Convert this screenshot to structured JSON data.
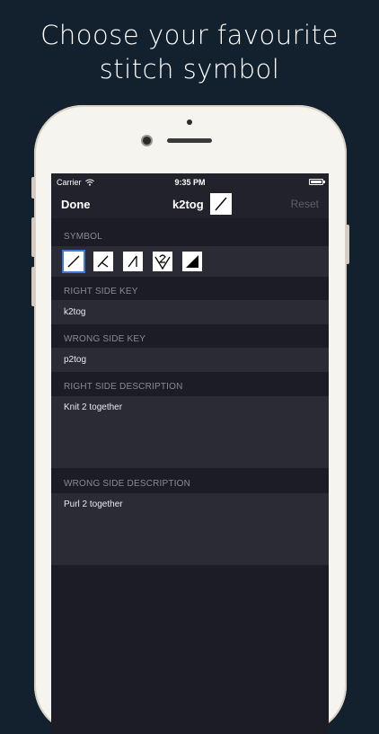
{
  "headline": {
    "line1": "Choose your favourite",
    "line2": "stitch symbol"
  },
  "status_bar": {
    "carrier": "Carrier",
    "time": "9:35 PM"
  },
  "nav": {
    "done_label": "Done",
    "title": "k2tog",
    "reset_label": "Reset"
  },
  "symbol_section": {
    "label": "SYMBOL",
    "options": [
      "k2tog-symbol-icon",
      "k-symbol-icon",
      "slash-left-symbol-icon",
      "twisted-two-symbol-icon",
      "bind-off-symbol-icon"
    ],
    "selected_index": 0
  },
  "right_side_key": {
    "label": "RIGHT SIDE KEY",
    "value": "k2tog"
  },
  "wrong_side_key": {
    "label": "WRONG SIDE KEY",
    "value": "p2tog"
  },
  "right_side_description": {
    "label": "RIGHT SIDE DESCRIPTION",
    "value": "Knit 2 together"
  },
  "wrong_side_description": {
    "label": "WRONG SIDE DESCRIPTION",
    "value": "Purl 2 together"
  },
  "colors": {
    "background": "#13202d",
    "screen": "#1c1c26",
    "row": "#2b2b36",
    "accent_selected": "#3a7bd5"
  }
}
